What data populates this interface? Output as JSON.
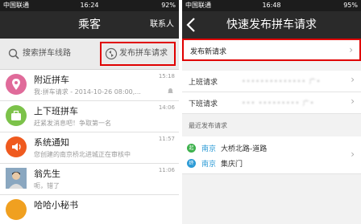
{
  "left": {
    "status": {
      "carrier": "中国联通",
      "time": "16:24",
      "battery": "92%"
    },
    "nav": {
      "title": "乘客",
      "contact": "联系人"
    },
    "search_label": "搜索拼车线路",
    "publish_label": "发布拼车请求",
    "rows": [
      {
        "title": "附近拼车",
        "subtitle": "我:拼车请求 - 2014-10-26 08:00,...",
        "time": "15:18",
        "icon": "location-pin-icon",
        "color": "#e06b9a"
      },
      {
        "title": "上下班拼车",
        "subtitle": "赶紧发消息吧！争取第一名",
        "time": "14:06",
        "icon": "briefcase-icon",
        "color": "#7cc24a"
      },
      {
        "title": "系统通知",
        "subtitle": "您创建的南京桥北进城正在审核中",
        "time": "11:57",
        "icon": "speaker-icon",
        "color": "#ef5a1f"
      },
      {
        "title": "翁先生",
        "subtitle": "呃，错了",
        "time": "11:06",
        "icon": "user-photo",
        "color": "#c9a27a"
      },
      {
        "title": "哈哈小秘书",
        "subtitle": "",
        "time": "",
        "icon": "bot-icon",
        "color": "#f0a020"
      }
    ]
  },
  "right": {
    "status": {
      "carrier": "中国联通",
      "time": "16:48",
      "battery": "95%"
    },
    "nav": {
      "title": "快速发布拼车请求"
    },
    "new_request": "发布新请求",
    "commute": [
      {
        "label": "上班请求",
        "value": "•••••••••••••• 广•"
      },
      {
        "label": "下班请求",
        "value": "••• ••••••••• 广•"
      }
    ],
    "recent_section": "最近发布请求",
    "recent": {
      "start_badge": "起",
      "end_badge": "终",
      "start_city": "南京",
      "start_place": "大桥北路-道路",
      "end_city": "南京",
      "end_place": "集庆门"
    },
    "colors": {
      "start": "#3db14c",
      "end": "#2d9bd6"
    }
  },
  "colors": {
    "highlight": "#e00000",
    "navbar": "#2a2a2a"
  }
}
